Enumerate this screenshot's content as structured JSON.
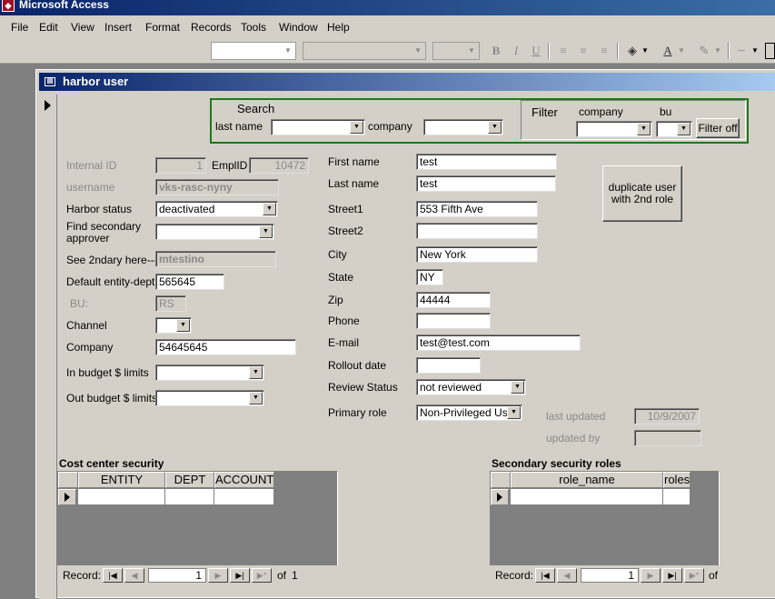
{
  "app": {
    "title": "Microsoft Access"
  },
  "menu": [
    "File",
    "Edit",
    "View",
    "Insert",
    "Format",
    "Records",
    "Tools",
    "Window",
    "Help"
  ],
  "toolbar": {
    "bold": "B",
    "italic": "I",
    "underline": "U"
  },
  "form": {
    "title": "harbor user",
    "search": {
      "heading": "Search",
      "last_name_label": "last name",
      "company_label": "company",
      "last_name_value": "",
      "company_value": ""
    },
    "filter": {
      "heading": "Filter",
      "company_label": "company",
      "bu_label": "bu",
      "company_value": "",
      "bu_value": "",
      "filter_off_label": "Filter off"
    },
    "left": {
      "internal_id_label": "Internal ID",
      "internal_id": "1",
      "emplid_label": "EmplID",
      "emplid": "10472",
      "username_label": "username",
      "username": "vks-rasc-nyny",
      "harbor_status_label": "Harbor status",
      "harbor_status": "deactivated",
      "find_secondary_label_1": "Find secondary",
      "find_secondary_label_2": "approver",
      "find_secondary": "",
      "see_2ndary_label": "See 2ndary here--->",
      "see_2ndary": "mtestino",
      "default_entity_label": "Default entity-dept",
      "default_entity": "565645",
      "bu_label": "BU:",
      "bu": "RS",
      "channel_label": "Channel",
      "channel": "",
      "company_label": "Company",
      "company": "54645645",
      "in_budget_label": "In budget $ limits",
      "in_budget": "",
      "out_budget_label": "Out budget $ limits",
      "out_budget": ""
    },
    "right": {
      "first_name_label": "First name",
      "first_name": "test",
      "last_name_label": "Last name",
      "last_name": "test",
      "street1_label": "Street1",
      "street1": "553 Fifth Ave",
      "street2_label": "Street2",
      "street2": "",
      "city_label": "City",
      "city": "New York",
      "state_label": "State",
      "state": "NY",
      "zip_label": "Zip",
      "zip": "44444",
      "phone_label": "Phone",
      "phone": "",
      "email_label": "E-mail",
      "email": "test@test.com",
      "rollout_label": "Rollout date",
      "rollout": "",
      "review_status_label": "Review Status",
      "review_status": "not reviewed",
      "primary_role_label": "Primary role",
      "primary_role": "Non-Privileged User",
      "last_updated_label": "last updated",
      "last_updated": "10/9/2007",
      "updated_by_label": "updated by",
      "updated_by": ""
    },
    "duplicate_button_line1": "duplicate user",
    "duplicate_button_line2": "with 2nd role",
    "cost_center": {
      "title": "Cost center security",
      "columns": [
        "ENTITY",
        "DEPT",
        "ACCOUNT"
      ],
      "record_label": "Record:",
      "record_num": "1",
      "of_label": "of",
      "total": "1"
    },
    "secondary_roles": {
      "title": "Secondary security roles",
      "columns": [
        "role_name",
        "roles"
      ],
      "record_label": "Record:",
      "record_num": "1",
      "of_label": "of"
    }
  }
}
